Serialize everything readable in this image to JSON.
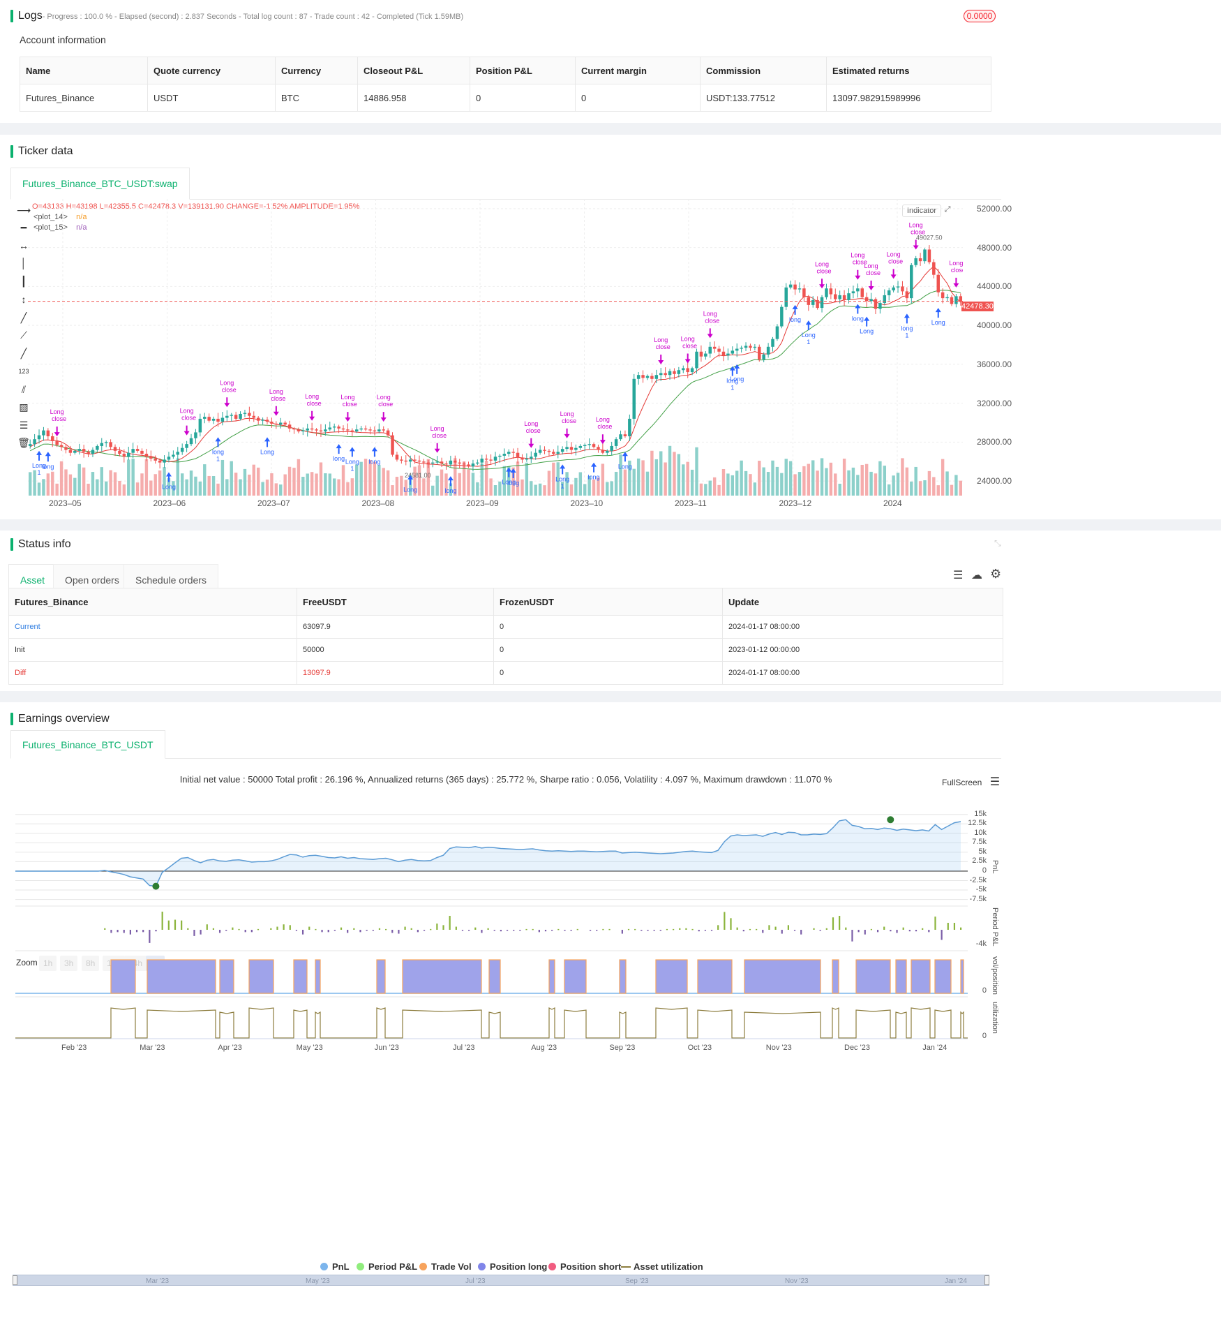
{
  "logs": {
    "title": "Logs",
    "progress_text": "- Progress : 100.0 % - Elapsed (second) : 2.837  Seconds - Total log count : 87 - Trade count : 42 - Completed (Tick 1.59MB)",
    "badge": "0.0000"
  },
  "account": {
    "title": "Account information",
    "columns": [
      "Name",
      "Quote currency",
      "Currency",
      "Closeout P&L",
      "Position P&L",
      "Current margin",
      "Commission",
      "Estimated returns"
    ],
    "row": [
      "Futures_Binance",
      "USDT",
      "BTC",
      "14886.958",
      "0",
      "0",
      "USDT:133.77512",
      "13097.982915989996"
    ]
  },
  "ticker": {
    "title": "Ticker data",
    "tab": "Futures_Binance_BTC_USDT:swap",
    "ohlc": {
      "o": "O=43133",
      "h": "H=43198",
      "l": "L=42355.5",
      "c": "C=42478.3",
      "v": "V=139131.90",
      "change": "CHANGE=-1.52%",
      "amplitude": "AMPLITUDE=1.95%"
    },
    "plot14": "<plot_14>",
    "plot15": "<plot_15>",
    "na": "n/a",
    "indicator_btn": "Indicator",
    "last_price": "42478.30",
    "high_label": "49027.50",
    "low_label": "24581.00",
    "y_ticks": [
      "52000.00",
      "48000.00",
      "44000.00",
      "40000.00",
      "36000.00",
      "32000.00",
      "28000.00",
      "24000.00"
    ],
    "x_ticks": [
      "2023–05",
      "2023–06",
      "2023–07",
      "2023–08",
      "2023–09",
      "2023–10",
      "2023–11",
      "2023–12",
      "2024"
    ],
    "marker_long": "Long",
    "marker_close": "close",
    "marker_long_lc": "long",
    "marker_one": "1"
  },
  "chart_data": {
    "type": "candlestick",
    "title": "",
    "y_range": [
      22500,
      53000
    ],
    "closes": [
      27800,
      28300,
      28700,
      29200,
      28600,
      28100,
      27700,
      27500,
      27200,
      26900,
      27100,
      27300,
      27000,
      26800,
      27200,
      27600,
      27900,
      28000,
      27500,
      27100,
      26800,
      26500,
      26900,
      27300,
      27100,
      26800,
      26500,
      26300,
      26100,
      25900,
      26200,
      26500,
      26700,
      27000,
      27400,
      27800,
      28400,
      29000,
      30400,
      30600,
      30200,
      30400,
      30100,
      30500,
      30700,
      30800,
      30400,
      30900,
      31000,
      30700,
      30500,
      30200,
      30300,
      30100,
      29900,
      29800,
      30000,
      29800,
      29400,
      29300,
      29100,
      29200,
      29400,
      29300,
      29200,
      29100,
      29300,
      29500,
      29600,
      29400,
      29300,
      29200,
      29100,
      29300,
      29400,
      29300,
      29200,
      29100,
      29300,
      29200,
      28700,
      26700,
      26200,
      26100,
      26000,
      26200,
      26100,
      26000,
      25900,
      25800,
      25900,
      26000,
      25800,
      25700,
      26100,
      25900,
      25800,
      25700,
      25500,
      25800,
      25900,
      26300,
      26200,
      26100,
      26500,
      26600,
      26800,
      27000,
      26900,
      26400,
      26200,
      26300,
      26500,
      26900,
      27200,
      27100,
      27000,
      26800,
      27000,
      27300,
      27500,
      27200,
      27400,
      27600,
      27700,
      27800,
      27500,
      27200,
      26900,
      27100,
      27600,
      28300,
      28800,
      28600,
      30400,
      34500,
      34900,
      34600,
      34800,
      34500,
      34900,
      35100,
      34900,
      35300,
      35000,
      35400,
      35600,
      35200,
      35600,
      37300,
      36800,
      37100,
      37800,
      37600,
      37300,
      36900,
      37100,
      37400,
      37600,
      37700,
      37900,
      37700,
      37800,
      36500,
      37000,
      37800,
      38600,
      39900,
      41900,
      43900,
      44200,
      43700,
      43800,
      42900,
      42100,
      42600,
      41800,
      42900,
      43800,
      43200,
      42700,
      43100,
      42600,
      43300,
      43500,
      43800,
      42900,
      42500,
      42700,
      41700,
      42300,
      43100,
      43600,
      43900,
      44000,
      43500,
      42800,
      46200,
      46900,
      46600,
      47800,
      46500,
      45200,
      43400,
      42800,
      42900,
      42200,
      43000,
      42478
    ]
  },
  "status": {
    "title": "Status info",
    "tabs": [
      "Asset",
      "Open orders",
      "Schedule orders"
    ],
    "columns": [
      "Futures_Binance",
      "FreeUSDT",
      "FrozenUSDT",
      "Update"
    ],
    "rows": [
      [
        "Current",
        "63097.9",
        "0",
        "2024-01-17 08:00:00"
      ],
      [
        "Init",
        "50000",
        "0",
        "2023-01-12 00:00:00"
      ],
      [
        "Diff",
        "13097.9",
        "0",
        "2024-01-17 08:00:00"
      ]
    ]
  },
  "earnings": {
    "title": "Earnings overview",
    "tab": "Futures_Binance_BTC_USDT",
    "summary": "Initial net value : 50000 Total profit : 26.196 %, Annualized returns (365 days) : 25.772 %, Sharpe ratio : 0.056, Volatility : 4.097 %, Maximum drawdown : 11.070 %",
    "fullscreen": "FullScreen",
    "zoom_label": "Zoom",
    "zoom_buttons": [
      "1h",
      "3h",
      "8h",
      "12h",
      "24h",
      "All"
    ],
    "pnl_ticks": [
      "15k",
      "12.5k",
      "10k",
      "7.5k",
      "5k",
      "2.5k",
      "0",
      "-2.5k",
      "-5k",
      "-7.5k"
    ],
    "period_tick": "-4k",
    "pos_tick": "0",
    "util_tick": "0",
    "axis_titles": [
      "PnL",
      "Period P&L",
      "vol/position",
      "utilization"
    ],
    "x_ticks": [
      "Feb '23",
      "Mar '23",
      "Apr '23",
      "May '23",
      "Jun '23",
      "Jul '23",
      "Aug '23",
      "Sep '23",
      "Oct '23",
      "Nov '23",
      "Dec '23",
      "Jan '24"
    ],
    "nav_ticks": [
      "Mar '23",
      "May '23",
      "Jul '23",
      "Sep '23",
      "Nov '23",
      "Jan '24"
    ],
    "legend": [
      "PnL",
      "Period P&L",
      "Trade Vol",
      "Position long",
      "Position short",
      "Asset utilization"
    ],
    "colors": {
      "pnl": "#7cb5ec",
      "period": "#90ed7d",
      "vol": "#f7a35c",
      "long": "#8085e9",
      "short": "#f15c80",
      "util": "#8d7d3e"
    }
  },
  "pnl_data": [
    0,
    0,
    0,
    0,
    0,
    0,
    0,
    0,
    0,
    0,
    0,
    0,
    0,
    0,
    200,
    -200,
    -500,
    -900,
    -1500,
    -1800,
    -2100,
    -3800,
    -4000,
    -300,
    900,
    2200,
    3400,
    3600,
    2800,
    2200,
    2900,
    3100,
    2700,
    2600,
    2900,
    3000,
    2700,
    2400,
    2500,
    2500,
    2700,
    3100,
    3800,
    4400,
    4300,
    3700,
    4100,
    4200,
    3900,
    3600,
    3500,
    3800,
    3400,
    3600,
    3300,
    3200,
    3100,
    3300,
    3400,
    3000,
    2500,
    2900,
    3100,
    2800,
    2700,
    2800,
    3600,
    4200,
    6000,
    6400,
    6300,
    6200,
    6500,
    6100,
    6300,
    6200,
    6000,
    5900,
    5800,
    5700,
    5800,
    5900,
    5600,
    5400,
    5300,
    5400,
    5300,
    5200,
    5300,
    5300,
    5200,
    5100,
    5200,
    5300,
    5300,
    4800,
    4900,
    5000,
    4900,
    4800,
    4700,
    4600,
    4700,
    4800,
    5000,
    5200,
    5300,
    5100,
    5000,
    4900,
    5500,
    7800,
    9300,
    9600,
    9400,
    9500,
    9600,
    9200,
    9800,
    10200,
    9700,
    10300,
    10200,
    9600,
    9600,
    9800,
    9700,
    9900,
    11500,
    13300,
    13600,
    12100,
    11800,
    11200,
    11300,
    11000,
    11400,
    11200,
    10800,
    11100,
    10900,
    10700,
    10900,
    10600,
    12300,
    11000,
    11900,
    12800,
    13100
  ]
}
